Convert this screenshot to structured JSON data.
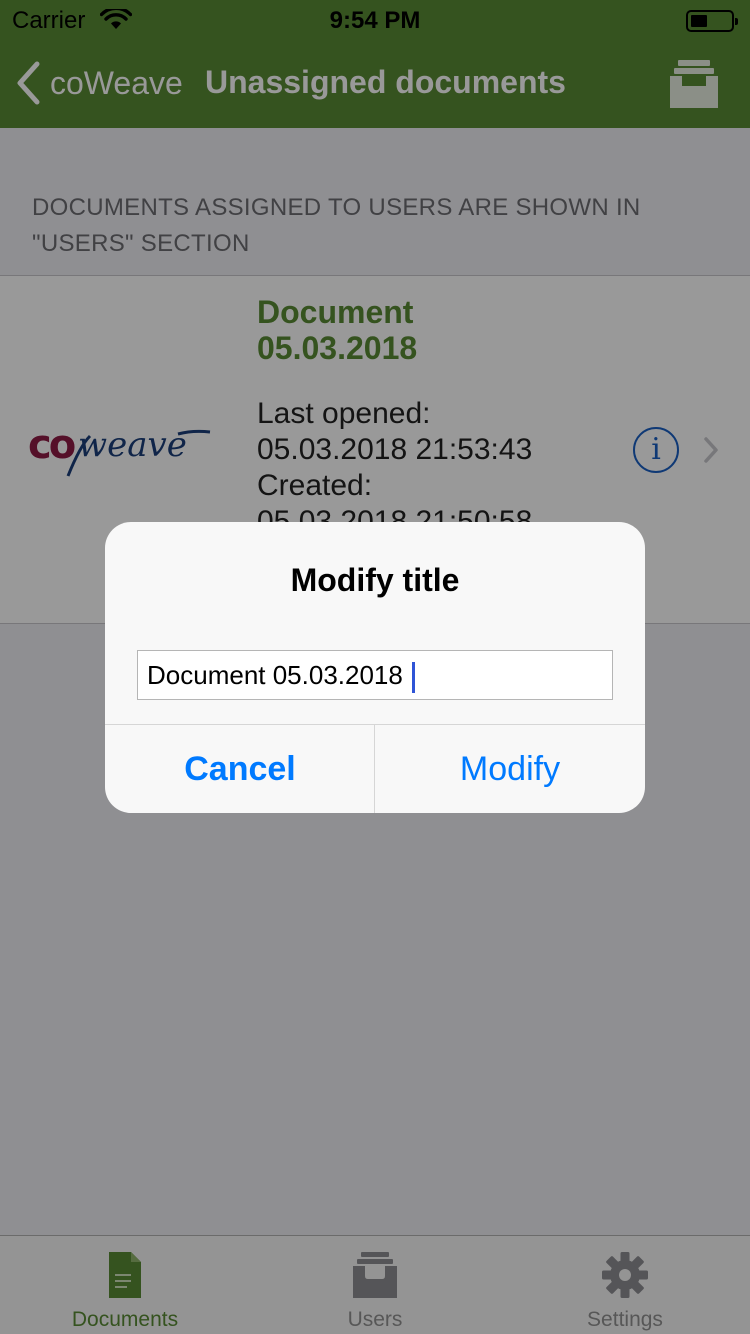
{
  "status_bar": {
    "carrier": "Carrier",
    "time": "9:54 PM"
  },
  "nav": {
    "back_label": "coWeave",
    "title": "Unassigned documents",
    "right_icon": "archive-box-icon"
  },
  "section_header": "DOCUMENTS ASSIGNED TO USERS ARE SHOWN IN \"USERS\" SECTION",
  "document": {
    "title_line1": "Document",
    "title_line2": "05.03.2018",
    "last_opened_label": "Last opened:",
    "last_opened_value": "05.03.2018 21:53:43",
    "created_label": "Created:",
    "created_value": "05.03.2018 21:50:58",
    "logo_text": "coweave"
  },
  "alert": {
    "title": "Modify title",
    "input_value": "Document 05.03.2018",
    "cancel_label": "Cancel",
    "modify_label": "Modify"
  },
  "tabs": [
    {
      "label": "Documents",
      "icon": "document-icon",
      "active": true
    },
    {
      "label": "Users",
      "icon": "archive-box-icon",
      "active": false
    },
    {
      "label": "Settings",
      "icon": "gear-icon",
      "active": false
    }
  ],
  "colors": {
    "brand_green": "#598a34",
    "ios_blue": "#007aff",
    "logo_maroon": "#8e1b45",
    "logo_navy": "#1b3f7a"
  }
}
